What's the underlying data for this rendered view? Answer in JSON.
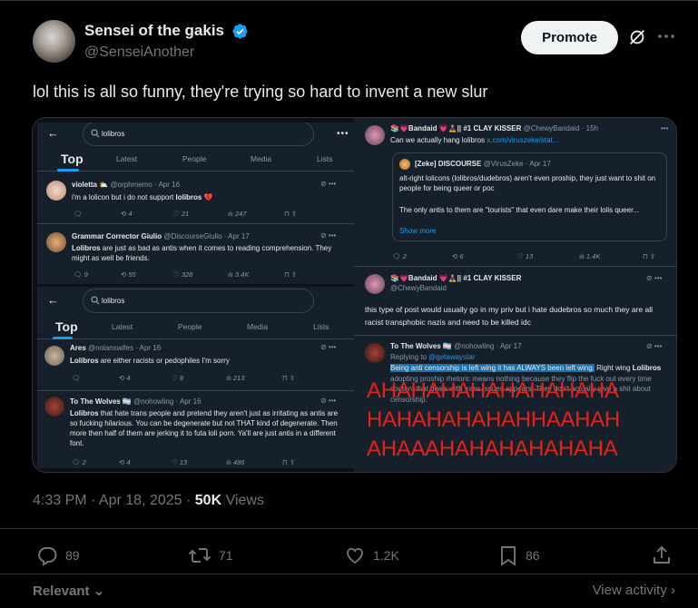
{
  "author": {
    "name": "Sensei of the gakis",
    "handle": "@SenseiAnother"
  },
  "header": {
    "promote_label": "Promote"
  },
  "tweet": {
    "text": "lol this is all so funny, they're trying so hard to invent a new slur",
    "time": "4:33 PM · Apr 18, 2025 · ",
    "views_count": "50K",
    "views_label": " Views"
  },
  "media": {
    "left_top": {
      "search": "lolibros",
      "tabs": [
        "Top",
        "Latest",
        "People",
        "Media",
        "Lists"
      ],
      "posts": [
        {
          "name": "violetta ⛅",
          "handle": "@orphmemo · Apr 16",
          "text_pre": "i'm a lolicon but i do not support ",
          "text_bold": "lolibros",
          "text_post": " 💔",
          "stats": [
            "",
            "4",
            "21",
            "247"
          ]
        },
        {
          "name": "Grammar Corrector Giulio",
          "handle": "@DiscourseGiulio · Apr 17",
          "text_bold": "Lolibros",
          "text_post": " are just as bad as antis when it comes to reading comprehension. They might as well be friends.",
          "stats": [
            "9",
            "55",
            "328",
            "3.4K"
          ]
        }
      ]
    },
    "left_bottom": {
      "search": "lolibros",
      "tabs": [
        "Top",
        "Latest",
        "People",
        "Media",
        "Lists"
      ],
      "posts": [
        {
          "name": "Ares",
          "handle": "@nolanswifes · Apr 16",
          "text_bold": "Lolibros",
          "text_post": " are either racists or pedophiles I'm sorry",
          "stats": [
            "",
            "4",
            "8",
            "213"
          ]
        },
        {
          "name": "To The Wolves 🏳️‍⚧️",
          "handle": "@nohowling · Apr 16",
          "text_bold": "Lolibros",
          "text_post": " that hate trans people and pretend they aren't just as irritating as antis are so fucking hilarious. You can be degenerate but not THAT kind of degenerate. Then more then half of them are jerking it to futa loli porn. Ya'll are just antis in a different font.",
          "stats": [
            "2",
            "4",
            "13",
            "486"
          ]
        }
      ]
    },
    "right": {
      "post1": {
        "name": "📚💗Bandaid 💗🧘‍♀️|| #1 CLAY KISSER",
        "handle": "@ChewyBandaid · 15h",
        "text": "Can we actually hang lolibros ",
        "link": "x.com/viruszeke/stat...",
        "quote_name": "[Zeke] DISCOURSE",
        "quote_handle": "@VirusZeke · Apr 17",
        "quote_text1": "alt-right lolicons (lolibros/dudebros) aren't even proship, they just want to shit on people for being queer or poc",
        "quote_text2": "The only antis to them are \"tourists\" that even dare make their lolis queer...",
        "show_more": "Show more",
        "stats": [
          "2",
          "6",
          "13",
          "1.4K"
        ]
      },
      "post2": {
        "name": "📚💗Bandaid 💗🧘‍♀️|| #1 CLAY KISSER",
        "handle": "@ChewyBandaid",
        "text": "this type of post would usually go in my priv but i hate dudebros so much they are all racist transphobic nazis and need to be killed idc"
      },
      "post3": {
        "name": "To The Wolves 🏳️‍⚧️",
        "handle": "@nohowling · Apr 17",
        "replying_label": "Replying to ",
        "replying_handle": "@getawaystar",
        "highlight": "Being anti censorship is left wing it has ALWAYS been left wing.",
        "text_after": " Right wing ",
        "text_bold": "Lolibros",
        "text_rest": " adopting proship rhetoric means nothing because they flip the fuck out every time content that deals with trans issues appears. They don't actually give a shit about censorship.",
        "laugh_lines": [
          "AHAHAHAHAHAHAHAHA",
          "HAHAHAHAHAHHAAHAH",
          "AHAAAHAHAHAHAHAHA"
        ]
      }
    }
  },
  "actions": {
    "replies": "89",
    "reposts": "71",
    "likes": "1.2K",
    "bookmarks": "86"
  },
  "footer": {
    "sort_label": "Relevant",
    "view_activity": "View activity"
  },
  "colors": {
    "accent": "#1d9bf0",
    "laugh_red": "#e8201a"
  }
}
